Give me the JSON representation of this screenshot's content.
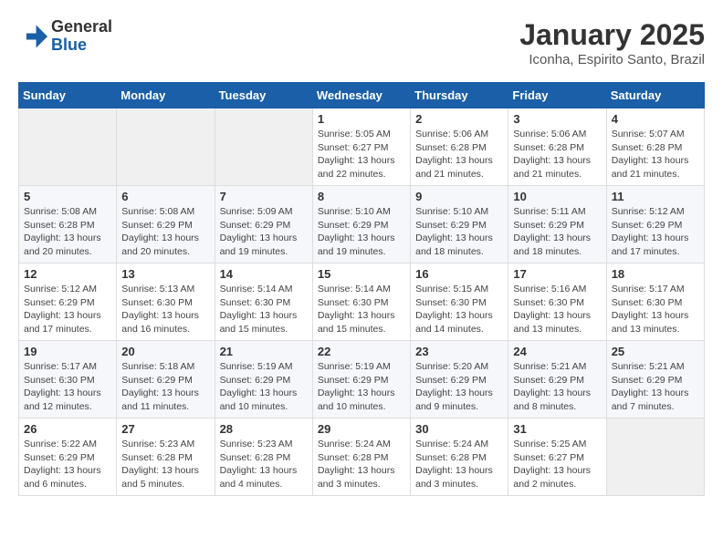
{
  "logo": {
    "line1": "General",
    "line2": "Blue"
  },
  "title": "January 2025",
  "location": "Iconha, Espirito Santo, Brazil",
  "days_of_week": [
    "Sunday",
    "Monday",
    "Tuesday",
    "Wednesday",
    "Thursday",
    "Friday",
    "Saturday"
  ],
  "weeks": [
    [
      {
        "num": "",
        "info": ""
      },
      {
        "num": "",
        "info": ""
      },
      {
        "num": "",
        "info": ""
      },
      {
        "num": "1",
        "info": "Sunrise: 5:05 AM\nSunset: 6:27 PM\nDaylight: 13 hours\nand 22 minutes."
      },
      {
        "num": "2",
        "info": "Sunrise: 5:06 AM\nSunset: 6:28 PM\nDaylight: 13 hours\nand 21 minutes."
      },
      {
        "num": "3",
        "info": "Sunrise: 5:06 AM\nSunset: 6:28 PM\nDaylight: 13 hours\nand 21 minutes."
      },
      {
        "num": "4",
        "info": "Sunrise: 5:07 AM\nSunset: 6:28 PM\nDaylight: 13 hours\nand 21 minutes."
      }
    ],
    [
      {
        "num": "5",
        "info": "Sunrise: 5:08 AM\nSunset: 6:28 PM\nDaylight: 13 hours\nand 20 minutes."
      },
      {
        "num": "6",
        "info": "Sunrise: 5:08 AM\nSunset: 6:29 PM\nDaylight: 13 hours\nand 20 minutes."
      },
      {
        "num": "7",
        "info": "Sunrise: 5:09 AM\nSunset: 6:29 PM\nDaylight: 13 hours\nand 19 minutes."
      },
      {
        "num": "8",
        "info": "Sunrise: 5:10 AM\nSunset: 6:29 PM\nDaylight: 13 hours\nand 19 minutes."
      },
      {
        "num": "9",
        "info": "Sunrise: 5:10 AM\nSunset: 6:29 PM\nDaylight: 13 hours\nand 18 minutes."
      },
      {
        "num": "10",
        "info": "Sunrise: 5:11 AM\nSunset: 6:29 PM\nDaylight: 13 hours\nand 18 minutes."
      },
      {
        "num": "11",
        "info": "Sunrise: 5:12 AM\nSunset: 6:29 PM\nDaylight: 13 hours\nand 17 minutes."
      }
    ],
    [
      {
        "num": "12",
        "info": "Sunrise: 5:12 AM\nSunset: 6:29 PM\nDaylight: 13 hours\nand 17 minutes."
      },
      {
        "num": "13",
        "info": "Sunrise: 5:13 AM\nSunset: 6:30 PM\nDaylight: 13 hours\nand 16 minutes."
      },
      {
        "num": "14",
        "info": "Sunrise: 5:14 AM\nSunset: 6:30 PM\nDaylight: 13 hours\nand 15 minutes."
      },
      {
        "num": "15",
        "info": "Sunrise: 5:14 AM\nSunset: 6:30 PM\nDaylight: 13 hours\nand 15 minutes."
      },
      {
        "num": "16",
        "info": "Sunrise: 5:15 AM\nSunset: 6:30 PM\nDaylight: 13 hours\nand 14 minutes."
      },
      {
        "num": "17",
        "info": "Sunrise: 5:16 AM\nSunset: 6:30 PM\nDaylight: 13 hours\nand 13 minutes."
      },
      {
        "num": "18",
        "info": "Sunrise: 5:17 AM\nSunset: 6:30 PM\nDaylight: 13 hours\nand 13 minutes."
      }
    ],
    [
      {
        "num": "19",
        "info": "Sunrise: 5:17 AM\nSunset: 6:30 PM\nDaylight: 13 hours\nand 12 minutes."
      },
      {
        "num": "20",
        "info": "Sunrise: 5:18 AM\nSunset: 6:29 PM\nDaylight: 13 hours\nand 11 minutes."
      },
      {
        "num": "21",
        "info": "Sunrise: 5:19 AM\nSunset: 6:29 PM\nDaylight: 13 hours\nand 10 minutes."
      },
      {
        "num": "22",
        "info": "Sunrise: 5:19 AM\nSunset: 6:29 PM\nDaylight: 13 hours\nand 10 minutes."
      },
      {
        "num": "23",
        "info": "Sunrise: 5:20 AM\nSunset: 6:29 PM\nDaylight: 13 hours\nand 9 minutes."
      },
      {
        "num": "24",
        "info": "Sunrise: 5:21 AM\nSunset: 6:29 PM\nDaylight: 13 hours\nand 8 minutes."
      },
      {
        "num": "25",
        "info": "Sunrise: 5:21 AM\nSunset: 6:29 PM\nDaylight: 13 hours\nand 7 minutes."
      }
    ],
    [
      {
        "num": "26",
        "info": "Sunrise: 5:22 AM\nSunset: 6:29 PM\nDaylight: 13 hours\nand 6 minutes."
      },
      {
        "num": "27",
        "info": "Sunrise: 5:23 AM\nSunset: 6:28 PM\nDaylight: 13 hours\nand 5 minutes."
      },
      {
        "num": "28",
        "info": "Sunrise: 5:23 AM\nSunset: 6:28 PM\nDaylight: 13 hours\nand 4 minutes."
      },
      {
        "num": "29",
        "info": "Sunrise: 5:24 AM\nSunset: 6:28 PM\nDaylight: 13 hours\nand 3 minutes."
      },
      {
        "num": "30",
        "info": "Sunrise: 5:24 AM\nSunset: 6:28 PM\nDaylight: 13 hours\nand 3 minutes."
      },
      {
        "num": "31",
        "info": "Sunrise: 5:25 AM\nSunset: 6:27 PM\nDaylight: 13 hours\nand 2 minutes."
      },
      {
        "num": "",
        "info": ""
      }
    ]
  ]
}
